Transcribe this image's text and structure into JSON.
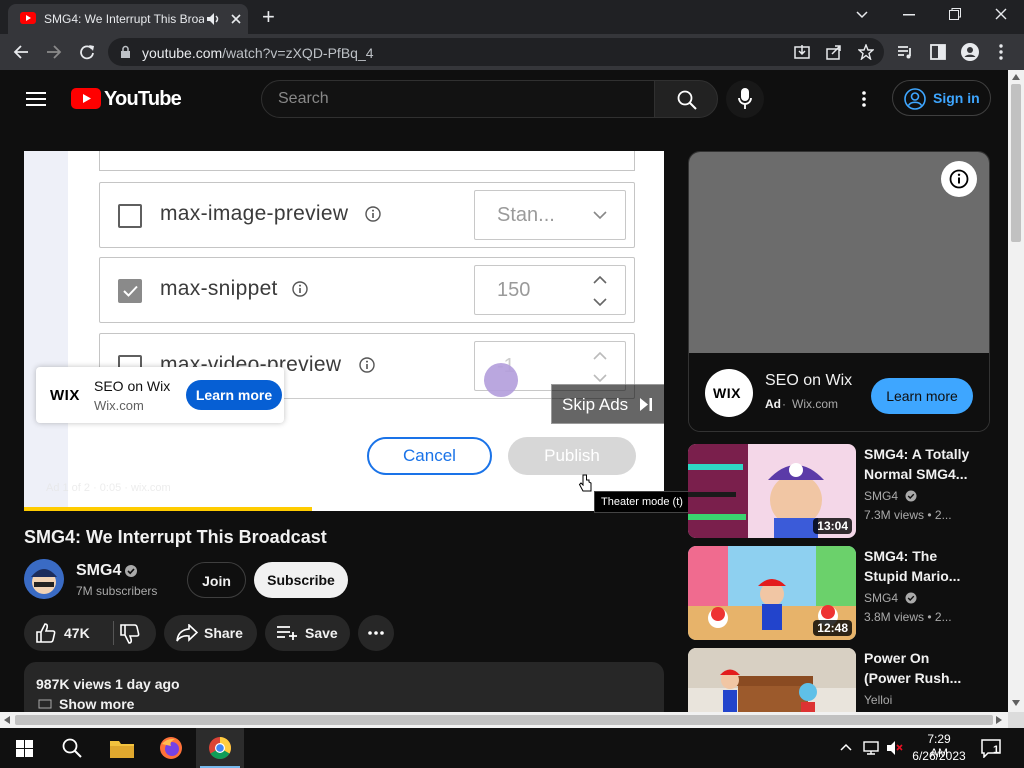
{
  "browser": {
    "tab_title": "SMG4: We Interrupt This Broadcast",
    "new_tab": "+",
    "url_host": "youtube.com",
    "url_path": "/watch?v=zXQD-PfBq_4"
  },
  "youtube": {
    "logo_text": "YouTube",
    "search_placeholder": "Search",
    "sign_in": "Sign in"
  },
  "player": {
    "rows": [
      {
        "label": "max-image-preview",
        "control_value": "Stan...",
        "checked": false
      },
      {
        "label": "max-snippet",
        "control_value": "150",
        "checked": true
      },
      {
        "label": "max-video-preview",
        "control_value": "-1",
        "checked": false
      }
    ],
    "ad_brand": "WIX",
    "ad_title": "SEO on Wix",
    "ad_domain": "Wix.com",
    "ad_learn_more": "Learn more",
    "skip_ads": "Skip Ads",
    "cancel": "Cancel",
    "publish": "Publish",
    "ad_info": "Ad 1 of 2 · 0:05 · wix.com",
    "progress_fraction": 0.45,
    "tooltip": "Theater mode (t)"
  },
  "video": {
    "title": "SMG4: We Interrupt This Broadcast",
    "channel": "SMG4",
    "subscribers": "7M subscribers",
    "join": "Join",
    "subscribe": "Subscribe",
    "likes": "47K",
    "share": "Share",
    "save": "Save",
    "views": "987K views",
    "posted": "1 day ago",
    "show_more": "Show more"
  },
  "sidebar_ad": {
    "brand": "WIX",
    "title": "SEO on Wix",
    "ad_label": "Ad",
    "domain": "Wix.com",
    "learn_more": "Learn more"
  },
  "recommendations": [
    {
      "title_line1": "SMG4: A Totally",
      "title_line2": "Normal SMG4...",
      "channel": "SMG4",
      "views": "7.3M views",
      "age": "2...",
      "duration": "13:04"
    },
    {
      "title_line1": "SMG4: The",
      "title_line2": "Stupid Mario...",
      "channel": "SMG4",
      "views": "3.8M views",
      "age": "2...",
      "duration": "12:48"
    },
    {
      "title_line1": "Power On",
      "title_line2": "(Power Rush...",
      "channel": "Yelloi",
      "views": "",
      "age": "",
      "duration": ""
    }
  ],
  "taskbar": {
    "time": "7:29 AM",
    "date": "6/26/2023",
    "notification_count": "1"
  },
  "colors": {
    "youtube_red": "#ff0000",
    "link_blue": "#3ea6ff",
    "ad_progress": "#ffcc00"
  }
}
